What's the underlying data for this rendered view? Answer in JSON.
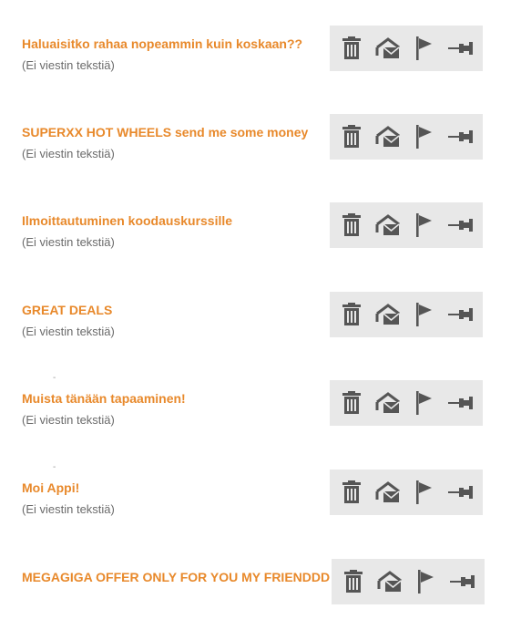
{
  "messages": [
    {
      "subject": "Haluaisitko rahaa nopeammin kuin koskaan??",
      "preview": "(Ei viestin tekstiä)",
      "dash": ""
    },
    {
      "subject": "SUPERXX HOT WHEELS send me some money",
      "preview": "(Ei viestin tekstiä)",
      "dash": ""
    },
    {
      "subject": "Ilmoittautuminen koodauskurssille",
      "preview": "(Ei viestin tekstiä)",
      "dash": ""
    },
    {
      "subject": "GREAT DEALS",
      "preview": "(Ei viestin tekstiä)",
      "dash": ""
    },
    {
      "subject": "Muista tänään tapaaminen!",
      "preview": "(Ei viestin tekstiä)",
      "dash": "-"
    },
    {
      "subject": "Moi Appi!",
      "preview": "(Ei viestin tekstiä)",
      "dash": "-"
    },
    {
      "subject": "MEGAGIGA OFFER ONLY FOR YOU MY FRIENDDD",
      "preview": "",
      "dash": ""
    }
  ],
  "action_icons": [
    "trash-icon",
    "mark-read-icon",
    "flag-icon",
    "pin-icon"
  ],
  "colors": {
    "subject": "#e8892b",
    "preview": "#6b6b6b",
    "action_bar": "#e8e8e8",
    "icon": "#555555"
  }
}
